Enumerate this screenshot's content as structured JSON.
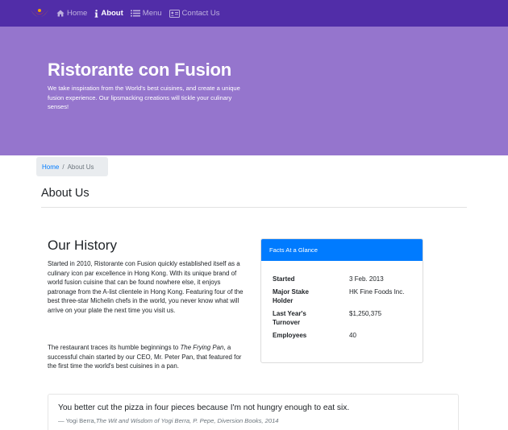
{
  "navbar": {
    "items": [
      {
        "icon": "home-icon",
        "label": "Home",
        "active": false
      },
      {
        "icon": "info-icon",
        "label": "About",
        "active": true
      },
      {
        "icon": "list-icon",
        "label": "Menu",
        "active": false
      },
      {
        "icon": "address-card-icon",
        "label": "Contact Us",
        "active": false
      }
    ],
    "colors": {
      "background": "#512da8",
      "active_text": "#ffffff"
    }
  },
  "jumbotron": {
    "title": "Ristorante con Fusion",
    "text": "We take inspiration from the World's best cuisines, and create a unique fusion experience. Our lipsmacking creations will tickle your culinary senses!",
    "background": "#9575cd"
  },
  "breadcrumb": {
    "home": "Home",
    "separator": "/",
    "current": "About Us"
  },
  "page": {
    "heading": "About Us"
  },
  "history": {
    "title": "Our History",
    "paragraph1": "Started in 2010, Ristorante con Fusion quickly established itself as a culinary icon par excellence in Hong Kong. With its unique brand of world fusion cuisine that can be found nowhere else, it enjoys patronage from the A-list clientele in Hong Kong. Featuring four of the best three-star Michelin chefs in the world, you never know what will arrive on your plate the next time you visit us.",
    "paragraph2_before": "The restaurant traces its humble beginnings to ",
    "paragraph2_italic": "The Frying Pan",
    "paragraph2_after": ", a successful chain started by our CEO, Mr. Peter Pan, that featured for the first time the world's best cuisines in a pan."
  },
  "facts": {
    "header": "Facts At a Glance",
    "header_color": "#007bff",
    "rows": [
      {
        "label": "Started",
        "value": "3 Feb. 2013"
      },
      {
        "label": "Major Stake Holder",
        "value": "HK Fine Foods Inc."
      },
      {
        "label": "Last Year's Turnover",
        "value": "$1,250,375"
      },
      {
        "label": "Employees",
        "value": "40"
      }
    ]
  },
  "quote": {
    "text": "You better cut the pizza in four pieces because I'm not hungry enough to eat six.",
    "attribution_prefix": "— Yogi Berra,",
    "attribution_source": "The Wit and Wisdom of Yogi Berra, P. Pepe, Diversion Books, 2014"
  }
}
